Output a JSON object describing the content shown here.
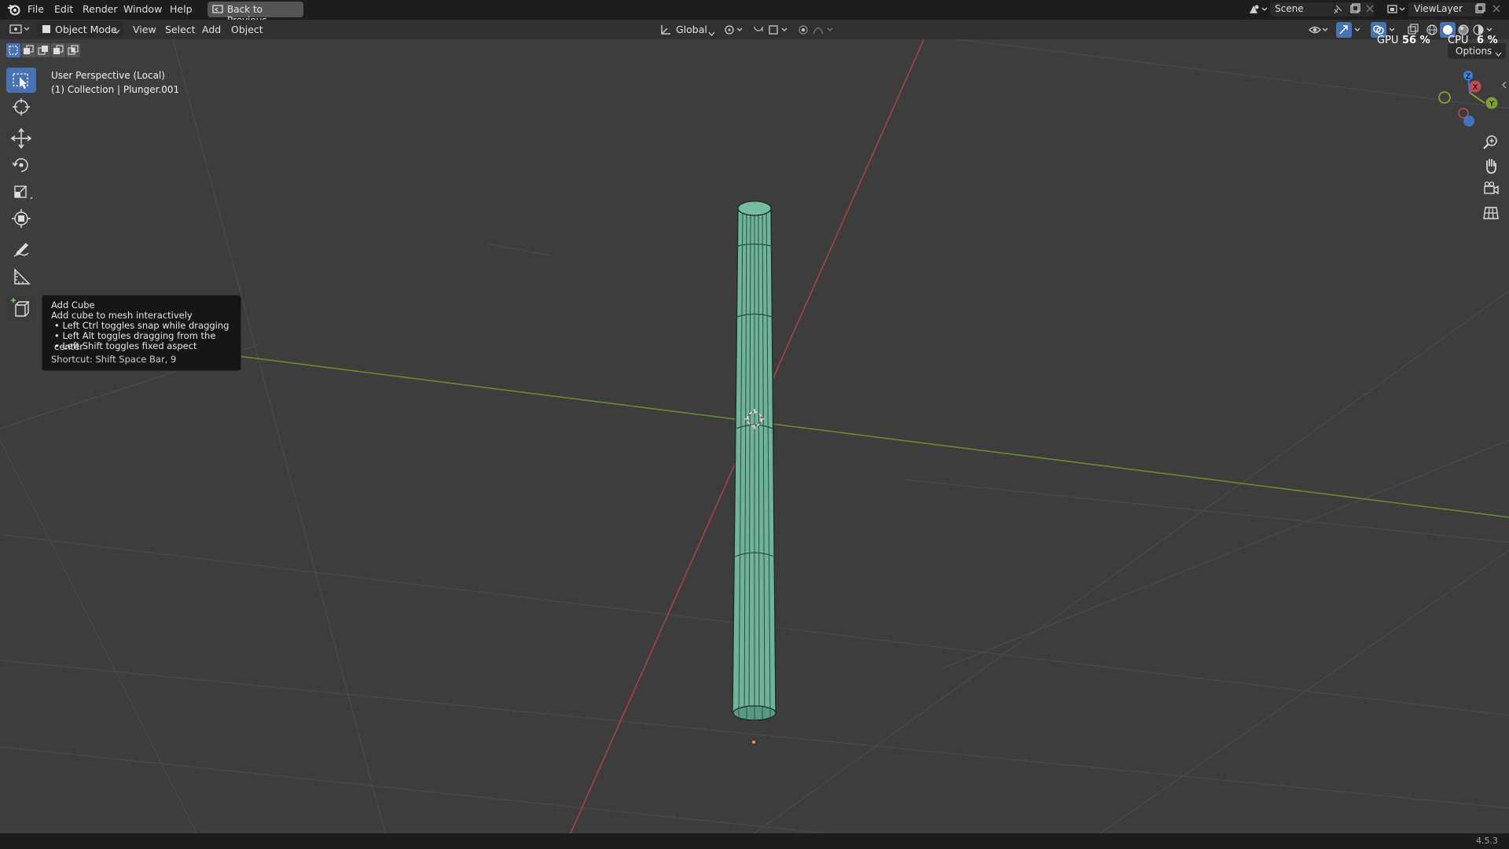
{
  "menubar": {
    "items": [
      "File",
      "Edit",
      "Render",
      "Window",
      "Help"
    ],
    "back_button": "Back to Previous",
    "scene_label": "Scene",
    "viewlayer_label": "ViewLayer",
    "gpu_label": "GPU",
    "gpu_value": "56 %",
    "cpu_label": "CPU",
    "cpu_value": "6 %"
  },
  "header": {
    "mode": "Object Mode",
    "menus": [
      "View",
      "Select",
      "Add",
      "Object"
    ],
    "transform_orientation": "Global",
    "options": "Options"
  },
  "viewport": {
    "view_name": "User Perspective (Local)",
    "collection_info": "(1) Collection | Plunger.001",
    "axis_colors": {
      "x": "#c44a52",
      "y": "#7ea02f",
      "z": "#3d7fd6"
    },
    "object_color": "#6fb39a"
  },
  "toolbar": {
    "tools": [
      "select-box",
      "cursor",
      "move",
      "rotate",
      "scale",
      "transform",
      "annotate",
      "measure",
      "add-cube"
    ],
    "active": "select-box"
  },
  "tooltip": {
    "title": "Add Cube",
    "description": "Add cube to mesh interactively",
    "bullets": [
      "• Left Ctrl toggles snap while dragging",
      "• Left Alt toggles dragging from the center",
      "• Left Shift toggles fixed aspect"
    ],
    "shortcut": "Shortcut: Shift Space Bar, 9"
  },
  "statusbar": {
    "version": "4.5.3"
  }
}
